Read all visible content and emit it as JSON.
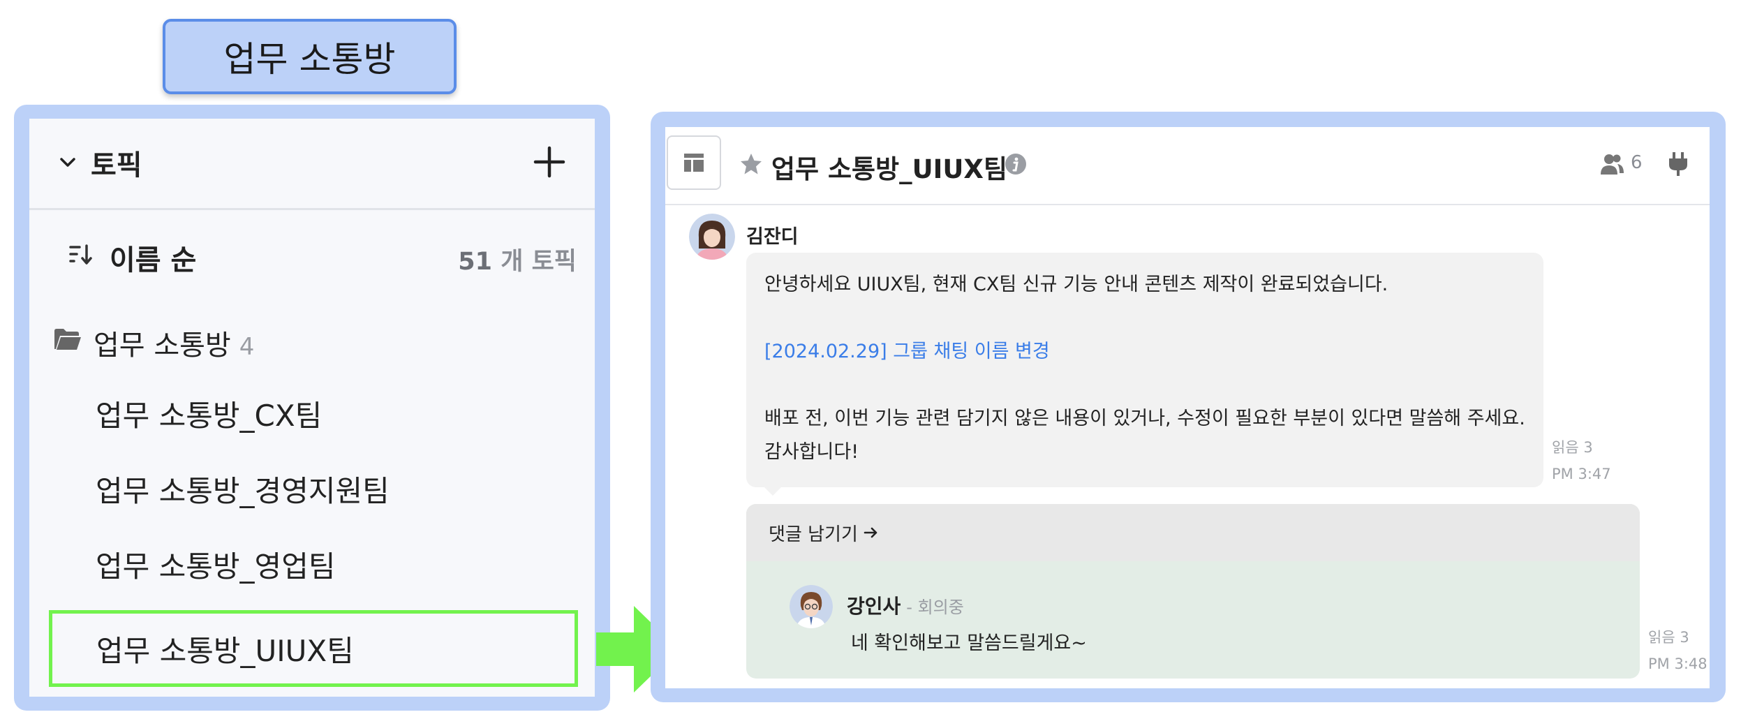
{
  "caption": "업무 소통방",
  "sidebar": {
    "section_title": "토픽",
    "sort_label": "이름 순",
    "topic_count_num": "51",
    "topic_count_unit": "개 토픽",
    "folder": {
      "label": "업무 소통방",
      "count": "4"
    },
    "items": [
      {
        "label": "업무 소통방_CX팀"
      },
      {
        "label": "업무 소통방_경영지원팀"
      },
      {
        "label": "업무 소통방_영업팀"
      },
      {
        "label": "업무 소통방_UIUX팀",
        "selected": true
      }
    ]
  },
  "chat": {
    "title": "업무 소통방_UIUX팀",
    "member_count": "6",
    "message": {
      "author": "김잔디",
      "line1": "안녕하세요 UIUX팀, 현재 CX팀 신규 기능 안내 콘텐츠 제작이 완료되었습니다.",
      "link": "[2024.02.29] 그룹 채팅 이름 변경",
      "line3": "배포 전, 이번 기능 관련 담기지 않은 내용이 있거나, 수정이 필요한 부분이 있다면 말씀해 주세요.",
      "line4": "감사합니다!",
      "read": "읽음 3",
      "time": "PM 3:47"
    },
    "thread": {
      "comment_label": "댓글 남기기",
      "reply": {
        "author": "강인사",
        "status": "- 회의중",
        "text": "네 확인해보고 말씀드릴게요~",
        "read": "읽음 3",
        "time": "PM 3:48"
      }
    }
  },
  "colors": {
    "frame": "#bcd1f8",
    "tag_border": "#5b8de8",
    "highlight": "#72f24d",
    "link": "#3a7de8",
    "thread_bg": "#e3ede6"
  },
  "icons": [
    "chevron-down-icon",
    "plus-icon",
    "sort-icon",
    "folder-icon",
    "layout-icon",
    "star-icon",
    "info-icon",
    "members-icon",
    "plug-icon",
    "arrow-right-icon"
  ]
}
